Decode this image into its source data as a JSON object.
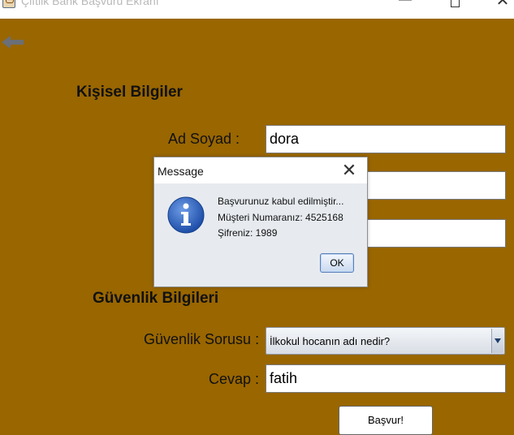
{
  "window": {
    "title": "Çiftlik Bank Başvuru Ekranı",
    "minimize_glyph": "—",
    "close_glyph": "✕"
  },
  "icons": {
    "app": "java-cup-icon",
    "back": "back-arrow-icon",
    "info": "information-icon",
    "dropdown": "dropdown-arrow-icon"
  },
  "colors": {
    "background": "#996600",
    "back_arrow": "#6b6f78",
    "info_blue": "#2257b5"
  },
  "personal": {
    "heading": "Kişisel Bilgiler",
    "name_label": "Ad Soyad :",
    "name_value": "dora"
  },
  "security": {
    "heading": "Güvenlik Bilgileri",
    "question_label": "Güvenlik Sorusu :",
    "question_selected": "İlkokul hocanın adı nedir?",
    "answer_label": "Cevap :",
    "answer_value": "fatih"
  },
  "apply_button": "Başvur!",
  "dialog": {
    "title": "Message",
    "close_glyph": "✕",
    "line1": "Başvurunuz kabul edilmiştir...",
    "line2": "Müşteri Numaranız: 4525168",
    "line3": "Şifreniz: 1989",
    "ok": "OK"
  }
}
